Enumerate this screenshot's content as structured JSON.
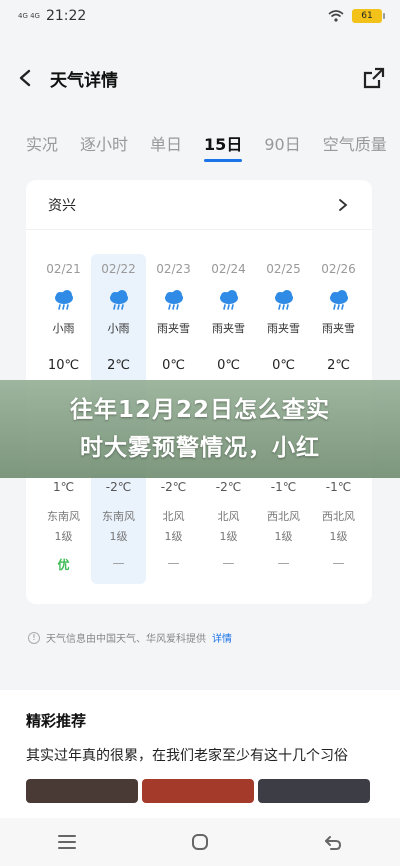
{
  "status_bar": {
    "network": "4G 4G",
    "time": "21:22",
    "battery": "61"
  },
  "header": {
    "title": "天气详情"
  },
  "tabs": [
    {
      "label": "实况"
    },
    {
      "label": "逐小时"
    },
    {
      "label": "单日"
    },
    {
      "label": "15日",
      "active": true
    },
    {
      "label": "90日"
    },
    {
      "label": "空气质量"
    }
  ],
  "card": {
    "city": "资兴",
    "days": [
      {
        "date": "02/21",
        "condition": "小雨",
        "icon": "rain-cloud-icon",
        "high": "10℃",
        "low": "1℃",
        "wind": "东南风",
        "level": "1级",
        "aqi": "优"
      },
      {
        "date": "02/22",
        "condition": "小雨",
        "icon": "rain-cloud-icon",
        "high": "2℃",
        "low": "-2℃",
        "wind": "东南风",
        "level": "1级",
        "aqi": "—"
      },
      {
        "date": "02/23",
        "condition": "雨夹雪",
        "icon": "rain-cloud-icon",
        "high": "0℃",
        "low": "-2℃",
        "wind": "北风",
        "level": "1级",
        "aqi": "—"
      },
      {
        "date": "02/24",
        "condition": "雨夹雪",
        "icon": "rain-cloud-icon",
        "high": "0℃",
        "low": "-2℃",
        "wind": "北风",
        "level": "1级",
        "aqi": "—"
      },
      {
        "date": "02/25",
        "condition": "雨夹雪",
        "icon": "rain-cloud-icon",
        "high": "0℃",
        "low": "-1℃",
        "wind": "西北风",
        "level": "1级",
        "aqi": "—"
      },
      {
        "date": "02/26",
        "condition": "雨夹雪",
        "icon": "rain-cloud-icon",
        "high": "2℃",
        "low": "-1℃",
        "wind": "西北风",
        "level": "1级",
        "aqi": "—"
      }
    ]
  },
  "source": {
    "text": "天气信息由中国天气、华风爱科提供",
    "link": "详情"
  },
  "recommend": {
    "title": "精彩推荐",
    "article": "其实过年真的很累，在我们老家至少有这十几个习俗"
  },
  "overlay": {
    "line1": "往年12月22日怎么查实",
    "line2": "时大雾预警情况，小红"
  },
  "colors": {
    "accent": "#1a73e8",
    "good": "#3cba54",
    "overlay": "#86a186"
  }
}
